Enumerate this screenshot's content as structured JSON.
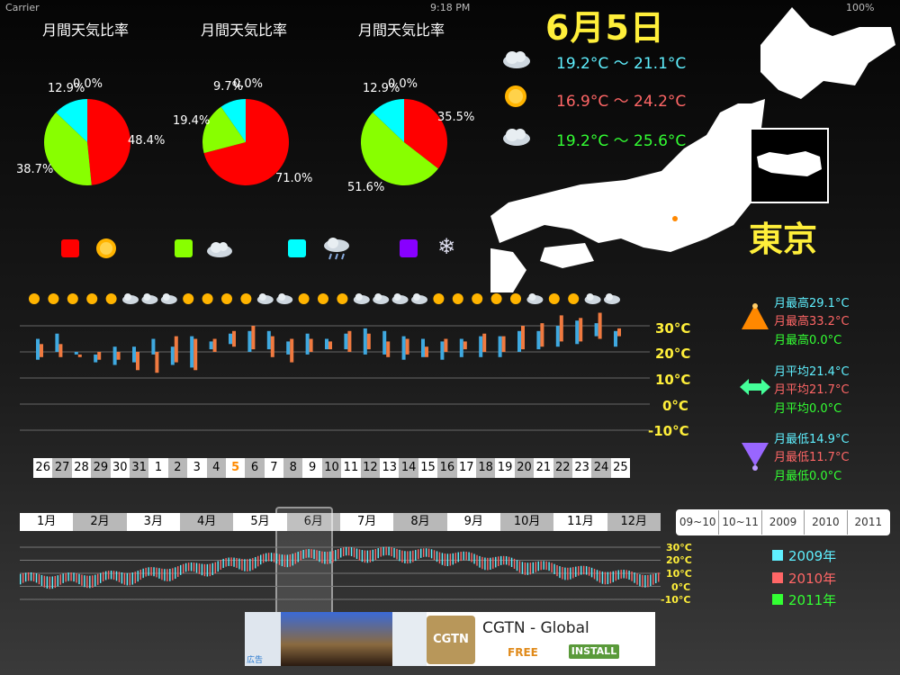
{
  "status_bar": {
    "carrier": "Carrier",
    "time": "9:18 PM",
    "battery": "100%"
  },
  "pies": [
    {
      "title": "月間天気比率",
      "title_color": "#5ff0ff",
      "slices": [
        {
          "label": "48.4%",
          "value": 48.4,
          "color": "#ff0000"
        },
        {
          "label": "38.7%",
          "value": 38.7,
          "color": "#88ff00"
        },
        {
          "label": "12.9%",
          "value": 12.9,
          "color": "#00ffff"
        },
        {
          "label": "0.0%",
          "value": 0.0,
          "color": "#8800ff"
        }
      ]
    },
    {
      "title": "月間天気比率",
      "title_color": "#ff6666",
      "slices": [
        {
          "label": "71.0%",
          "value": 71.0,
          "color": "#ff0000"
        },
        {
          "label": "19.4%",
          "value": 19.4,
          "color": "#88ff00"
        },
        {
          "label": "9.7%",
          "value": 9.7,
          "color": "#00ffff"
        },
        {
          "label": "0.0%",
          "value": 0.0,
          "color": "#8800ff"
        }
      ]
    },
    {
      "title": "月間天気比率",
      "title_color": "#33ff33",
      "slices": [
        {
          "label": "35.5%",
          "value": 35.5,
          "color": "#ff0000"
        },
        {
          "label": "51.6%",
          "value": 51.6,
          "color": "#88ff00"
        },
        {
          "label": "12.9%",
          "value": 12.9,
          "color": "#00ffff"
        },
        {
          "label": "0.0%",
          "value": 0.0,
          "color": "#8800ff"
        }
      ]
    }
  ],
  "date": "6月5日",
  "temps": [
    {
      "text": "19.2°C ～ 21.1°C",
      "color": "#5ff0ff",
      "icon": "cloud-icon"
    },
    {
      "text": "16.9°C ～ 24.2°C",
      "color": "#ff6666",
      "icon": "sun-icon"
    },
    {
      "text": "19.2°C ～ 25.6°C",
      "color": "#33ff33",
      "icon": "cloud-icon"
    }
  ],
  "city": "東京",
  "weather_legend": [
    {
      "color": "#ff0000",
      "icon": "sun-icon"
    },
    {
      "color": "#88ff00",
      "icon": "cloud-icon"
    },
    {
      "color": "#00ffff",
      "icon": "rain-icon"
    },
    {
      "color": "#8800ff",
      "icon": "snow-icon"
    }
  ],
  "chart_data": [
    {
      "type": "bar",
      "title": "",
      "ylabel": "",
      "yticks": [
        "30°C",
        "20°C",
        "10°C",
        "0°C",
        "-10°C"
      ],
      "ylim": [
        -10,
        30
      ],
      "categories": [
        "26",
        "27",
        "28",
        "29",
        "30",
        "31",
        "1",
        "2",
        "3",
        "4",
        "5",
        "6",
        "7",
        "8",
        "9",
        "10",
        "11",
        "12",
        "13",
        "14",
        "15",
        "16",
        "17",
        "18",
        "19",
        "20",
        "21",
        "22",
        "23",
        "24",
        "25"
      ],
      "series": [
        {
          "color": "#3fa9e0",
          "ranges": [
            [
              17,
              25
            ],
            [
              20,
              27
            ],
            [
              19,
              20
            ],
            [
              16,
              19
            ],
            [
              15,
              22
            ],
            [
              16,
              22
            ],
            [
              19,
              25
            ],
            [
              15,
              22
            ],
            [
              14,
              26
            ],
            [
              21,
              24
            ],
            [
              23,
              27
            ],
            [
              20,
              28
            ],
            [
              21,
              28
            ],
            [
              19,
              24
            ],
            [
              19,
              27
            ],
            [
              21,
              25
            ],
            [
              21,
              27
            ],
            [
              19,
              29
            ],
            [
              19,
              28
            ],
            [
              17,
              26
            ],
            [
              18,
              25
            ],
            [
              17,
              24
            ],
            [
              18,
              25
            ],
            [
              18,
              26
            ],
            [
              18,
              26
            ],
            [
              20,
              28
            ],
            [
              21,
              28
            ],
            [
              22,
              30
            ],
            [
              23,
              32
            ],
            [
              26,
              31
            ],
            [
              22,
              28
            ]
          ]
        },
        {
          "color": "#f07a40",
          "ranges": [
            [
              18,
              23
            ],
            [
              18,
              23
            ],
            [
              18,
              19
            ],
            [
              17,
              20
            ],
            [
              17,
              20
            ],
            [
              13,
              20
            ],
            [
              12,
              20
            ],
            [
              16,
              26
            ],
            [
              13,
              25
            ],
            [
              20,
              25
            ],
            [
              22,
              28
            ],
            [
              21,
              30
            ],
            [
              18,
              26
            ],
            [
              16,
              25
            ],
            [
              20,
              25
            ],
            [
              21,
              24
            ],
            [
              20,
              28
            ],
            [
              21,
              27
            ],
            [
              18,
              24
            ],
            [
              19,
              25
            ],
            [
              18,
              22
            ],
            [
              20,
              25
            ],
            [
              21,
              24
            ],
            [
              20,
              27
            ],
            [
              20,
              26
            ],
            [
              21,
              30
            ],
            [
              22,
              31
            ],
            [
              24,
              34
            ],
            [
              24,
              33
            ],
            [
              25,
              35
            ],
            [
              26,
              29
            ]
          ]
        }
      ],
      "highlight_category": "5",
      "icons": [
        "sun",
        "sun",
        "sun",
        "sun",
        "sun",
        "cloud",
        "cloud",
        "cloud",
        "sun",
        "sun",
        "sun",
        "sun",
        "cloud",
        "cloud",
        "sun",
        "sun",
        "sun",
        "cloud",
        "cloud",
        "cloud",
        "cloud",
        "sun",
        "sun",
        "sun",
        "sun",
        "sun",
        "cloud",
        "sun",
        "sun",
        "cloud",
        "cloud"
      ]
    },
    {
      "type": "bar",
      "title": "",
      "yticks": [
        "30°C",
        "20°C",
        "10°C",
        "0°C",
        "-10°C"
      ],
      "ylim": [
        -10,
        30
      ],
      "categories": [
        "1月",
        "2月",
        "3月",
        "4月",
        "5月",
        "6月",
        "7月",
        "8月",
        "9月",
        "10月",
        "11月",
        "12月"
      ],
      "highlight_category": "6月",
      "series": [
        {
          "name": "2009年",
          "color": "#5ff0ff"
        },
        {
          "name": "2010年",
          "color": "#ff6666"
        },
        {
          "name": "2011年",
          "color": "#33ff33"
        }
      ]
    }
  ],
  "year_tabs": [
    "09~10",
    "10~11",
    "2009",
    "2010",
    "2011"
  ],
  "stats": [
    {
      "icon": "max-arrow-icon",
      "lines": [
        {
          "text": "月最高29.1°C",
          "color": "#5ff0ff"
        },
        {
          "text": "月最高33.2°C",
          "color": "#ff6666"
        },
        {
          "text": "月最高0.0°C",
          "color": "#33ff33"
        }
      ]
    },
    {
      "icon": "avg-arrow-icon",
      "lines": [
        {
          "text": "月平均21.4°C",
          "color": "#5ff0ff"
        },
        {
          "text": "月平均21.7°C",
          "color": "#ff6666"
        },
        {
          "text": "月平均0.0°C",
          "color": "#33ff33"
        }
      ]
    },
    {
      "icon": "min-arrow-icon",
      "lines": [
        {
          "text": "月最低14.9°C",
          "color": "#5ff0ff"
        },
        {
          "text": "月最低11.7°C",
          "color": "#ff6666"
        },
        {
          "text": "月最低0.0°C",
          "color": "#33ff33"
        }
      ]
    }
  ],
  "ad": {
    "app_name": "CGTN - Global",
    "price": "FREE",
    "button": "INSTALL",
    "logo": "CGTN",
    "tag": "広告"
  }
}
